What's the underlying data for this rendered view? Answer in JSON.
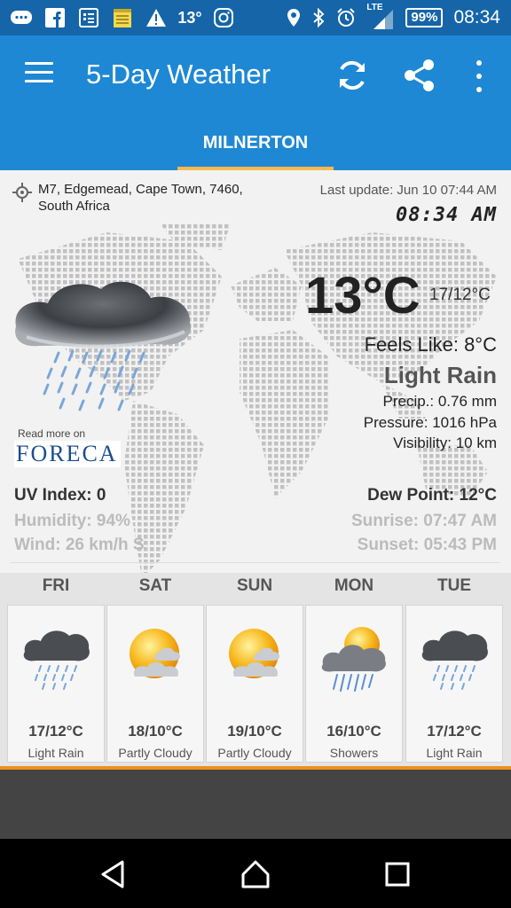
{
  "status_bar": {
    "icons": [
      "message-icon",
      "facebook-icon",
      "news-icon",
      "notes-icon",
      "warning-icon",
      "temperature-icon",
      "instagram-icon",
      "location-icon",
      "bluetooth-icon",
      "alarm-icon",
      "signal-icon"
    ],
    "temp": "13°",
    "network": "LTE",
    "battery": "99%",
    "time": "08:34"
  },
  "app_bar": {
    "title": "5-Day Weather",
    "icons": [
      "menu-icon",
      "refresh-icon",
      "share-icon",
      "more-icon"
    ]
  },
  "tabs": [
    {
      "label": "MILNERTON",
      "selected": true
    }
  ],
  "location": {
    "address": "M7, Edgemead, Cape Town, 7460, South Africa",
    "last_update": "Last update: Jun 10  07:44 AM",
    "time": "08:34 AM"
  },
  "current": {
    "temp": "13°C",
    "range": "17/12°C",
    "feels_like": "Feels Like: 8°C",
    "condition": "Light Rain",
    "precip": "Precip.: 0.76 mm",
    "pressure": "Pressure: 1016 hPa",
    "visibility": "Visibility: 10 km",
    "icon": "light-rain-icon"
  },
  "details": {
    "uv": "UV Index: 0",
    "dew": "Dew Point: 12°C",
    "humidity": "Humidity: 94%",
    "sunrise": "Sunrise: 07:47 AM",
    "wind": "Wind: 26 km/h S",
    "sunset": "Sunset: 05:43 PM"
  },
  "provider": {
    "read_more": "Read more on",
    "name": "FORECA"
  },
  "forecast": [
    {
      "day": "FRI",
      "temp": "17/12°C",
      "condition": "Light Rain",
      "icon": "light-rain-icon"
    },
    {
      "day": "SAT",
      "temp": "18/10°C",
      "condition": "Partly Cloudy",
      "icon": "partly-cloudy-icon"
    },
    {
      "day": "SUN",
      "temp": "19/10°C",
      "condition": "Partly Cloudy",
      "icon": "partly-cloudy-icon"
    },
    {
      "day": "MON",
      "temp": "16/10°C",
      "condition": "Showers",
      "icon": "showers-icon"
    },
    {
      "day": "TUE",
      "temp": "17/12°C",
      "condition": "Light Rain",
      "icon": "light-rain-icon"
    }
  ],
  "colors": {
    "status_bar": "#1565a8",
    "app_bar": "#1e88d4",
    "tab_indicator": "#ffb74d",
    "accent": "#ef8f1c"
  }
}
